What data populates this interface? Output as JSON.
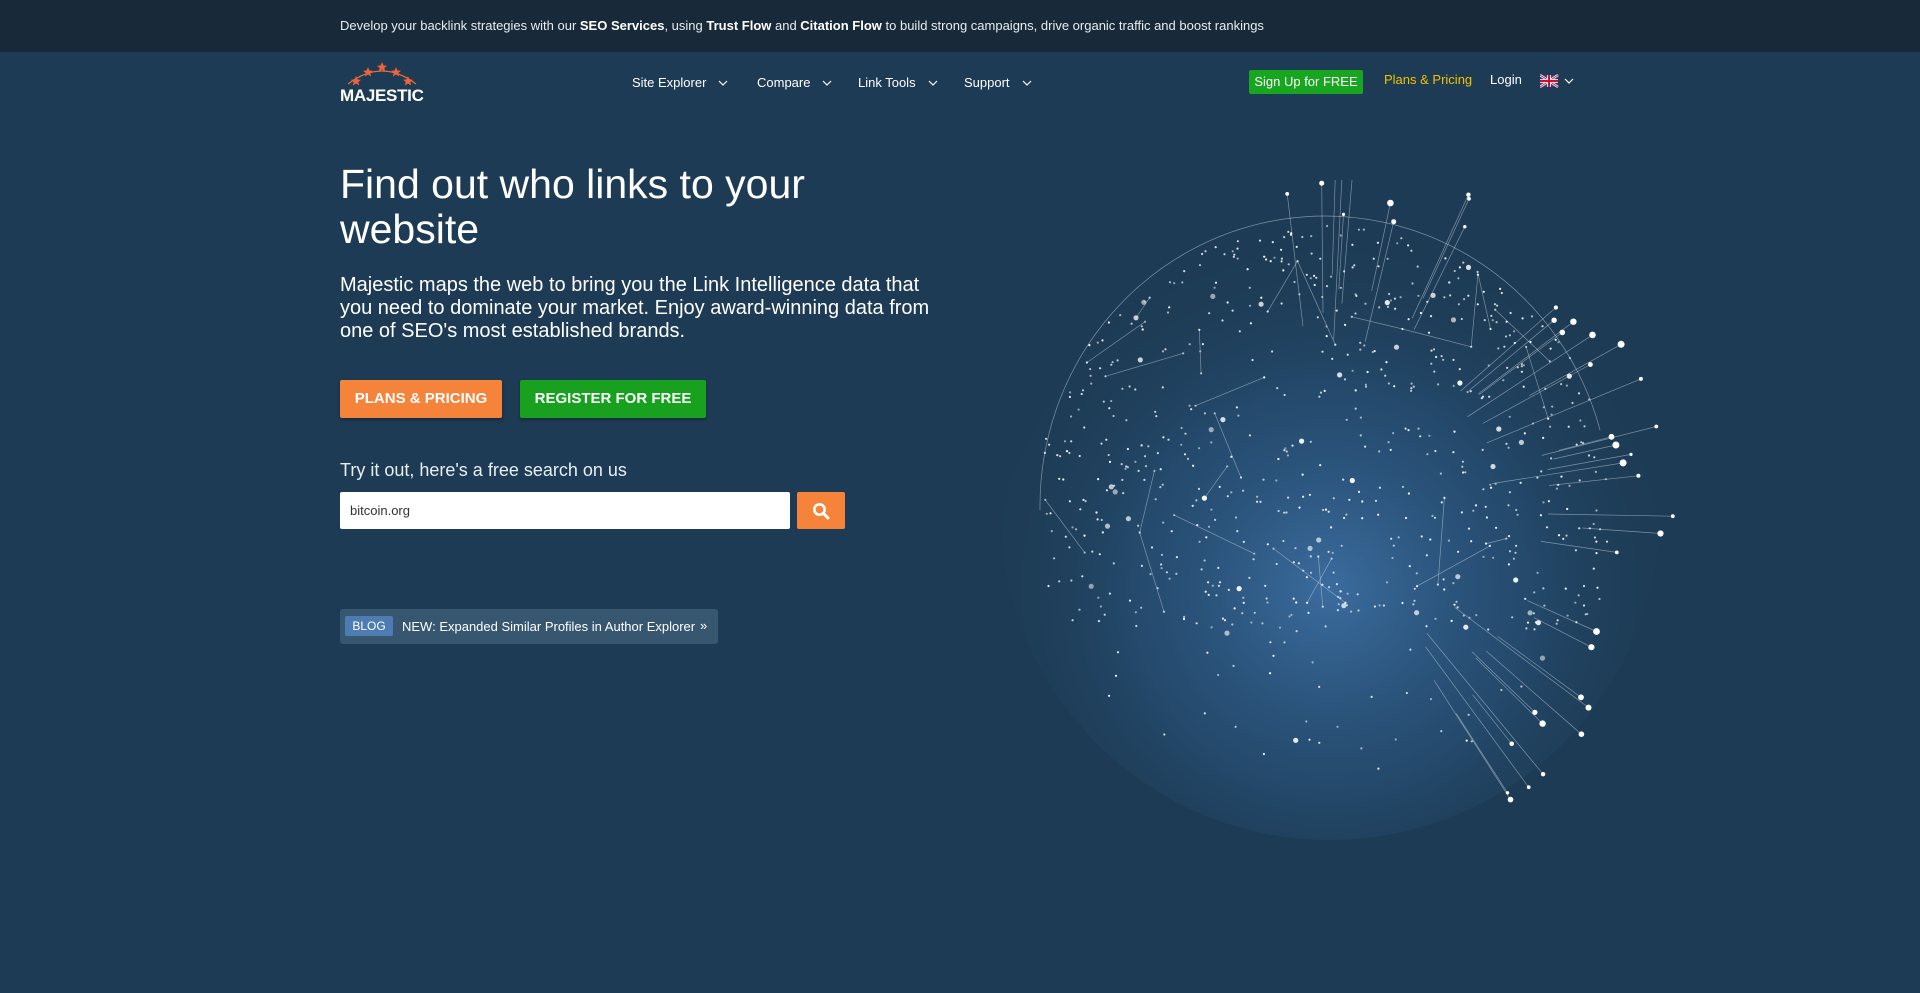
{
  "topbar": {
    "part1": "Develop your backlink strategies with our ",
    "seo_services": "SEO Services",
    "part2": ", using ",
    "trust_flow": "Trust Flow",
    "part3": " and ",
    "citation_flow": "Citation Flow",
    "part4": " to build strong campaigns, drive organic traffic and boost rankings"
  },
  "logo": {
    "text": "MAJESTIC"
  },
  "nav": {
    "items": [
      {
        "label": "Site Explorer"
      },
      {
        "label": "Compare"
      },
      {
        "label": "Link Tools"
      },
      {
        "label": "Support"
      }
    ]
  },
  "header_actions": {
    "signup_label": "Sign Up for FREE",
    "plans_label": "Plans & Pricing",
    "login_label": "Login",
    "language_icon": "uk-flag-icon"
  },
  "hero": {
    "title": "Find out who links to your website",
    "subtitle": "Majestic maps the web to bring you the Link Intelligence data that you need to dominate your market. Enjoy award-winning data from one of SEO's most established brands.",
    "plans_button": "PLANS & PRICING",
    "register_button": "REGISTER FOR FREE"
  },
  "search": {
    "label": "Try it out, here's a free search on us",
    "value": "bitcoin.org",
    "icon": "search-icon"
  },
  "blog": {
    "badge": "BLOG",
    "text": "NEW: Expanded Similar Profiles in Author Explorer",
    "arrow": "»"
  },
  "colors": {
    "background": "#1d3b54",
    "topbar": "#182a39",
    "accent_orange": "#f5833a",
    "accent_green": "#17a11f",
    "link_yellow": "#f2c100",
    "blog_badge": "#4d7cb3"
  }
}
